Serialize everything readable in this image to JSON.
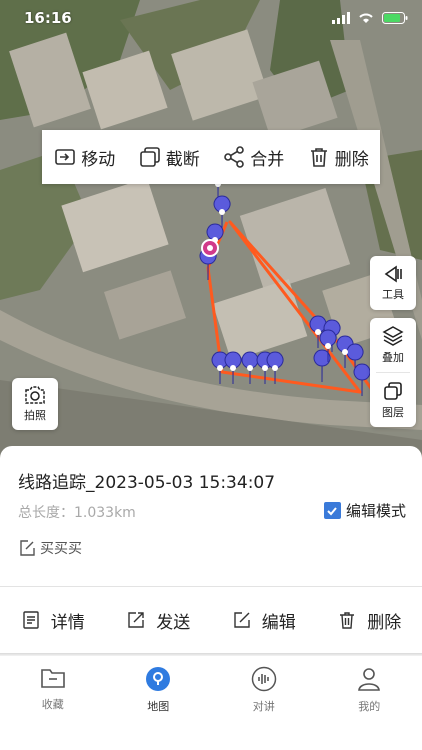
{
  "status": {
    "time": "16:16"
  },
  "edit_toolbar": {
    "move": "移动",
    "cut": "截断",
    "merge": "合并",
    "delete": "删除"
  },
  "side": {
    "tools": "工具",
    "overlay": "叠加",
    "layers": "图层",
    "photo": "拍照"
  },
  "track": {
    "title": "线路追踪_2023-05-03 15:34:07",
    "length": "总长度：1.033km",
    "edit_mode": "编辑模式",
    "edit_mode_checked": true,
    "note": "买买买"
  },
  "actions": {
    "detail": "详情",
    "send": "发送",
    "edit": "编辑",
    "delete": "删除"
  },
  "tabs": [
    {
      "label": "收藏"
    },
    {
      "label": "地图"
    },
    {
      "label": "对讲"
    },
    {
      "label": "我的"
    }
  ],
  "colors": {
    "route": "#ff5a1f",
    "pin": "#5b5bdc",
    "accent": "#3a7ad9"
  }
}
